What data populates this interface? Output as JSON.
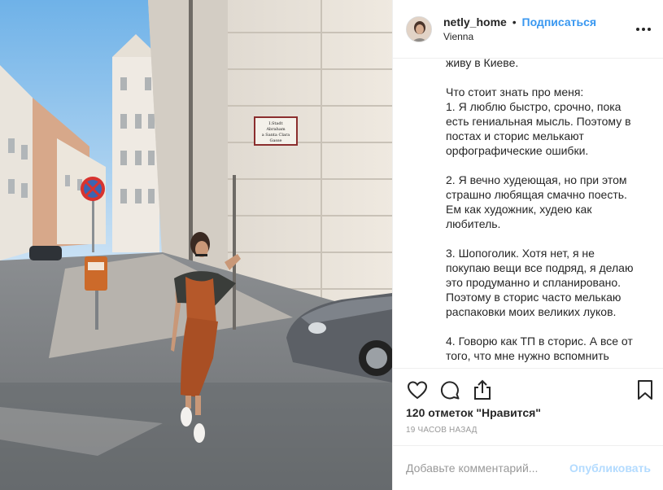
{
  "post": {
    "username": "netly_home",
    "separator": "•",
    "follow_label": "Подписаться",
    "location": "Vienna"
  },
  "photo": {
    "street_sign_lines": [
      "I.Stadt",
      "Abraham",
      "a Santa Clara",
      "Gasse"
    ]
  },
  "caption": {
    "lines": [
      "живу в Киеве.",
      "",
      "Что стоит знать про меня:",
      "1. Я люблю быстро, срочно, пока",
      "есть гениальная мысль. Поэтому в",
      "постах и сторис мелькают",
      "орфографические ошибки.",
      "",
      "2. Я вечно худеющая, но при этом",
      "страшно любящая смачно поесть.",
      "Ем как художник, худею как",
      "любитель.",
      "",
      "3. Шопоголик. Хотя нет, я не",
      "покупаю вещи все подряд, я делаю",
      "это продуманно и спланировано.",
      "Поэтому в сторис часто мелькаю",
      "распаковки моих великих луков.",
      "",
      "4. Говорю как ТП в сторис. А все от",
      "того, что мне нужно вспомнить"
    ]
  },
  "actions": {
    "likes_text": "120 отметок \"Нравится\"",
    "time_text": "19 ЧАСОВ НАЗАД",
    "icons": [
      "heart-icon",
      "comment-icon",
      "share-icon",
      "bookmark-icon"
    ]
  },
  "comment": {
    "placeholder": "Добавьте комментарий...",
    "publish_label": "Опубликовать"
  },
  "colors": {
    "accent": "#3897f0",
    "publish_disabled": "#b3dbff",
    "text": "#262626",
    "muted": "#999999",
    "dress": "#b5582a",
    "sky": "#8ec3ec"
  }
}
